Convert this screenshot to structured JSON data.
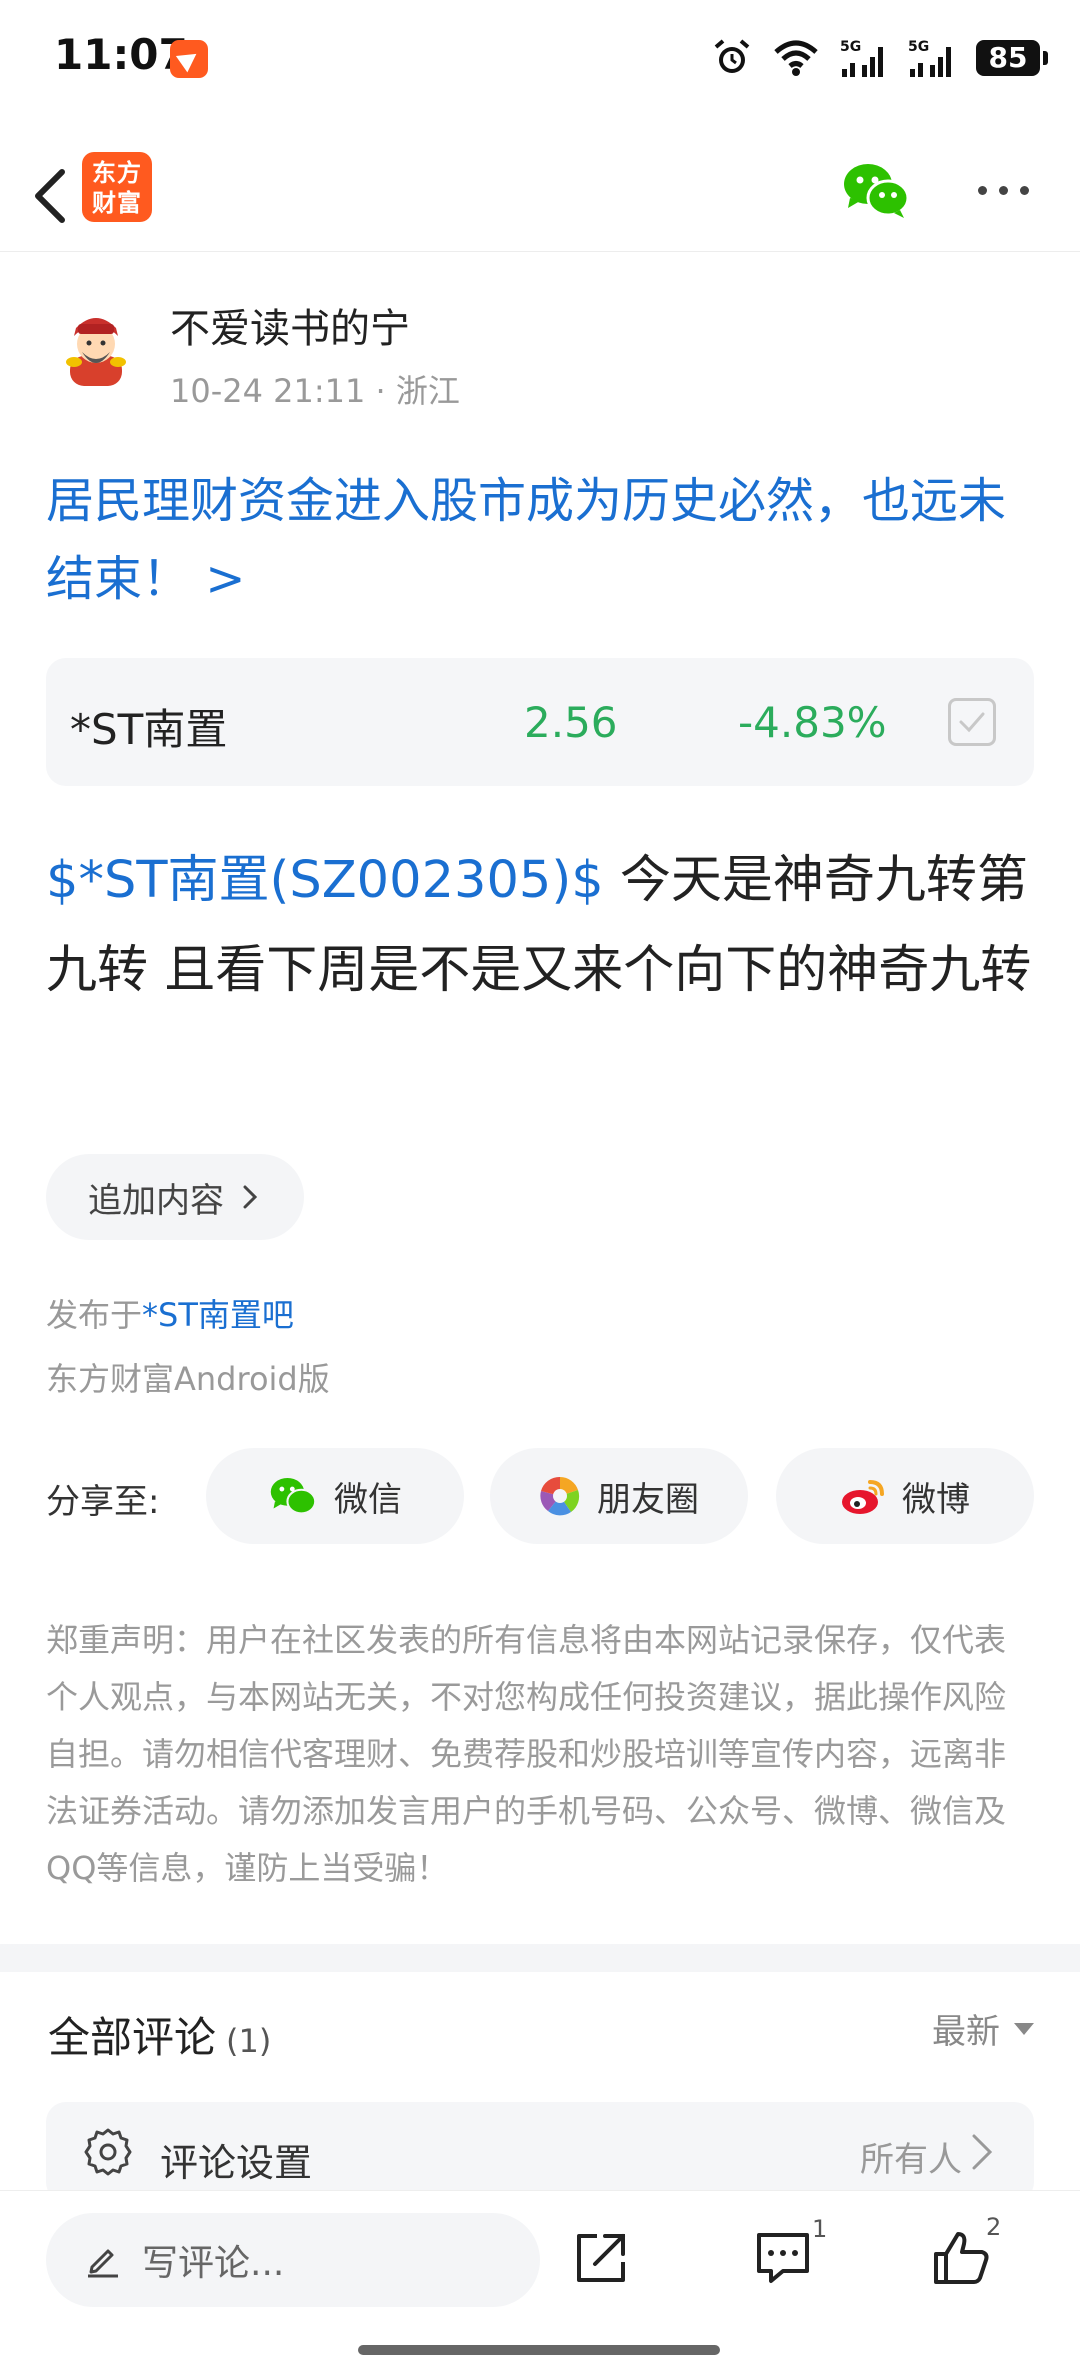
{
  "status_bar": {
    "time": "11:07",
    "battery": "85",
    "icons": [
      "alarm-icon",
      "wifi-icon",
      "5g-signal-icon",
      "5g-signal-icon"
    ]
  },
  "nav": {
    "logo_line1": "东方",
    "logo_line2": "财富"
  },
  "author": {
    "name": "不爱读书的宁",
    "meta": "10-24 21:11 · 浙江"
  },
  "topic": {
    "title": "居民理财资金进入股市成为历史必然，也远未结束！ >"
  },
  "stock": {
    "name": "*ST南置",
    "price": "2.56",
    "change": "-4.83%",
    "color": "#2bac5c"
  },
  "post": {
    "stock_tag": "$*ST南置(SZ002305)$",
    "body": " 今天是神奇九转第九转  且看下周是不是又来个向下的神奇九转"
  },
  "append_button": {
    "label": "追加内容"
  },
  "publish": {
    "prefix": "发布于",
    "forum": "*ST南置吧",
    "client": "东方财富Android版"
  },
  "share": {
    "label": "分享至:",
    "buttons": [
      {
        "label": "微信",
        "icon": "wechat-icon"
      },
      {
        "label": "朋友圈",
        "icon": "moments-icon"
      },
      {
        "label": "微博",
        "icon": "weibo-icon"
      }
    ]
  },
  "disclaimer": "郑重声明：用户在社区发表的所有信息将由本网站记录保存，仅代表个人观点，与本网站无关，不对您构成任何投资建议，据此操作风险自担。请勿相信代客理财、免费荐股和炒股培训等宣传内容，远离非法证券活动。请勿添加发言用户的手机号码、公众号、微博、微信及QQ等信息，谨防上当受骗！",
  "comments": {
    "title": "全部评论",
    "count": "(1)",
    "sort": "最新",
    "settings_label": "评论设置",
    "settings_value": "所有人"
  },
  "bottom_bar": {
    "input_placeholder": "写评论...",
    "comment_badge": "1",
    "like_badge": "2"
  },
  "colors": {
    "accent_blue": "#1a6fd1",
    "brand_orange": "#ff5a1f",
    "down_green": "#2bac5c"
  }
}
